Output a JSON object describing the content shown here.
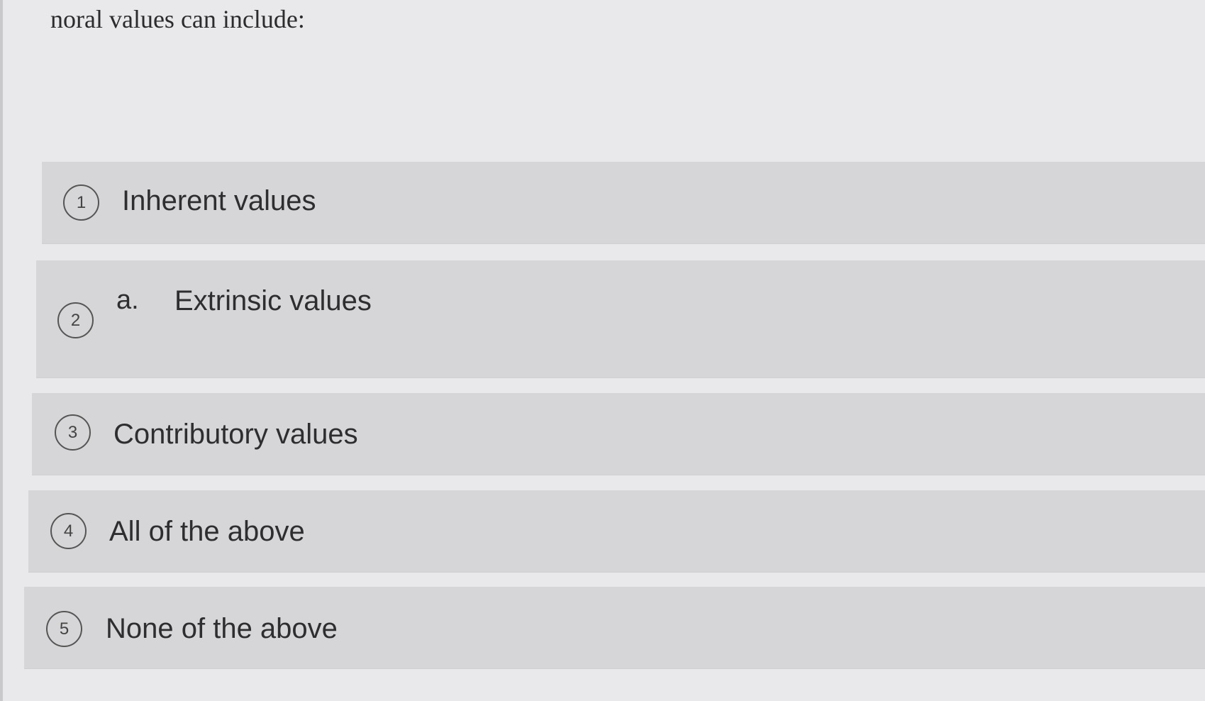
{
  "question": {
    "text": "noral values can include:"
  },
  "options": [
    {
      "number": "1",
      "label": "Inherent values"
    },
    {
      "number": "2",
      "prefix": "a.",
      "label": "Extrinsic values"
    },
    {
      "number": "3",
      "label": "Contributory values"
    },
    {
      "number": "4",
      "label": "All of the above"
    },
    {
      "number": "5",
      "label": "None of the above"
    }
  ],
  "colors": {
    "background": "#e9e9eb",
    "option_background": "#d6d6d8",
    "text": "#2e2e30"
  }
}
